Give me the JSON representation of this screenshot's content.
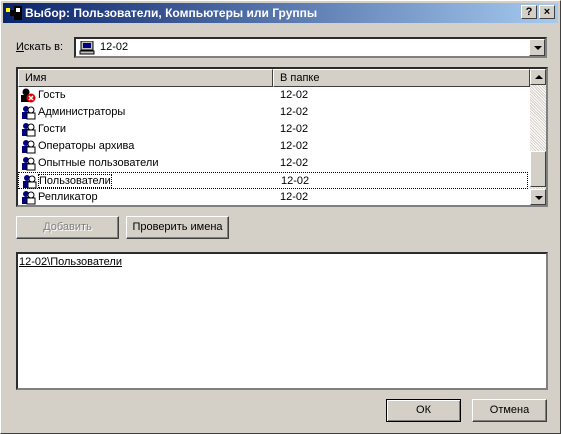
{
  "window": {
    "title": "Выбор: Пользователи, Компьютеры или Группы",
    "help_label": "?",
    "close_label": "×"
  },
  "lookin": {
    "label_underlined": "И",
    "label_rest": "скать в:",
    "value": "12-02"
  },
  "list": {
    "columns": [
      "Имя",
      "В папке"
    ],
    "rows": [
      {
        "name": "Гость",
        "folder": "12-02",
        "icon": "disabled-user-icon"
      },
      {
        "name": "Администраторы",
        "folder": "12-02",
        "icon": "group-icon"
      },
      {
        "name": "Гости",
        "folder": "12-02",
        "icon": "group-icon"
      },
      {
        "name": "Операторы архива",
        "folder": "12-02",
        "icon": "group-icon"
      },
      {
        "name": "Опытные пользователи",
        "folder": "12-02",
        "icon": "group-icon"
      },
      {
        "name": "Пользователи",
        "folder": "12-02",
        "icon": "group-icon",
        "selected": true
      },
      {
        "name": "Репликатор",
        "folder": "12-02",
        "icon": "group-icon"
      }
    ]
  },
  "buttons": {
    "add": "Добавить",
    "check_names": "Проверить имена",
    "ok": "ОК",
    "cancel": "Отмена"
  },
  "selection_text": "12-02\\Пользователи",
  "colors": {
    "title_start": "#0a246a",
    "title_end": "#a6caf0",
    "face": "#d4d0c8"
  }
}
